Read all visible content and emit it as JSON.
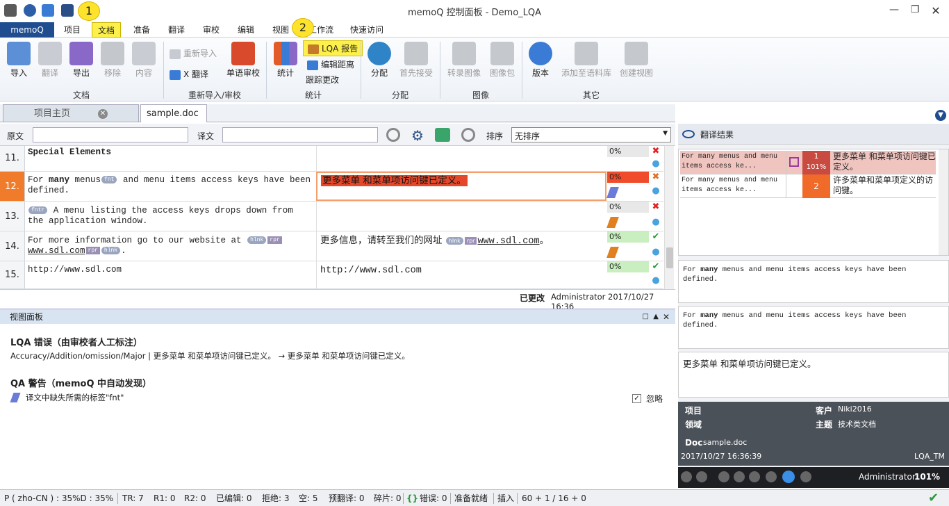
{
  "window": {
    "title": "memoQ 控制面板 - Demo_LQA"
  },
  "callouts": {
    "one": "1",
    "two": "2"
  },
  "tabs": {
    "memoq": "memoQ",
    "project": "项目",
    "document": "文档",
    "prepare": "准备",
    "translate": "翻译",
    "review": "审校",
    "edit": "编辑",
    "view": "视图",
    "workflow": "工作流",
    "quick": "快速访问"
  },
  "ribbon": {
    "import": "导入",
    "translate": "翻译",
    "export": "导出",
    "remove": "移除",
    "content": "内容",
    "group_doc": "文档",
    "reimport": "重新导入",
    "xtranslate": "X 翻译",
    "bilingual_review": "单语审校",
    "group_reimport": "重新导入/审校",
    "stats": "统计",
    "lqa_report": "LQA 报告",
    "edit_distance": "编辑距离",
    "track_changes": "跟踪更改",
    "group_stats": "统计",
    "assign": "分配",
    "first_accept": "首先接受",
    "group_assign": "分配",
    "transcribe_image": "转录图像",
    "image_pack": "图像包",
    "group_image": "图像",
    "version": "版本",
    "add_to_corpus": "添加至语料库",
    "create_view": "创建视图",
    "group_other": "其它"
  },
  "doctabs": {
    "home": "项目主页",
    "doc": "sample.doc"
  },
  "filter": {
    "source_label": "原文",
    "target_label": "译文",
    "sort_label": "排序",
    "sort_value": "无排序",
    "source_value": "",
    "target_value": ""
  },
  "rows": [
    {
      "num": "11.",
      "src": "Special Elements",
      "tgt": "",
      "pct": "0%"
    },
    {
      "num": "12.",
      "src_a": "For ",
      "src_b": "many",
      "src_c": " menus",
      "tag1": "fnt",
      "src_d": " and menu items access keys have been defined.",
      "tgt": "更多菜单 和菜单项访问键已定义。",
      "pct": "0%"
    },
    {
      "num": "13.",
      "tag1": "fntr",
      "src": " A menu listing the access keys drops down from the application window.",
      "tgt": "",
      "pct": "0%"
    },
    {
      "num": "14.",
      "src_a": "For more information go to our website at ",
      "tag1": "hlnk",
      "tag2": "rpr",
      "src_b": "www.sdl.com",
      "tag3": "rpr",
      "tag4": "hlnk",
      "src_c": ".",
      "tgt_a": "更多信息，请转至我们的网址 ",
      "tgt_b": "www.sdl.com",
      "tgt_c": "。",
      "pct": "0%"
    },
    {
      "num": "15.",
      "src": "http://www.sdl.com",
      "tgt": "http://www.sdl.com",
      "pct": "0%"
    }
  ],
  "editinfo": {
    "status": "已更改",
    "who": "Administrator 2017/10/27 16:36"
  },
  "viewpanel": {
    "title": "视图面板",
    "lqa_heading": "LQA 错误（由审校者人工标注）",
    "lqa_line": "Accuracy/Addition/omission/Major |   更多菜单 和菜单项访问键已定义。 → 更多菜单 和菜单项访问键已定义。",
    "qa_heading": "QA 警告（memoQ 中自动发现）",
    "qa_line": "译文中缺失所需的标签\"fnt\"",
    "ignore": "忽略"
  },
  "right": {
    "title": "翻译结果",
    "r1_src": "For many menus  and menu items access ke... ",
    "r1_num": "1",
    "r1_pct": "101%",
    "r1_tgt": "更多菜单 和菜单项访问键已定义。",
    "r2_src": "For many menus  and menu items access ke... ",
    "r2_num": "2",
    "r2_tgt": "许多菜单和菜单项定义的访问键。",
    "cmp1_a": "For ",
    "cmp1_b": "many",
    "cmp1_c": " menus  and menu items access keys have been defined.",
    "cmp2_a": "For ",
    "cmp2_b": "many",
    "cmp2_c": " menus  and menu items access keys have been defined.",
    "cmp3": "更多菜单 和菜单项访问键已定义。",
    "meta": {
      "project_label": "项目",
      "domain_label": "领域",
      "client_label": "客户",
      "client": "Niki2016",
      "subject_label": "主题",
      "subject": "技术类文档",
      "doc_label": "Doc",
      "doc": "sample.doc",
      "date": "2017/10/27 16:36:39",
      "tm": "LQA_TM"
    },
    "user": "Administrator",
    "zoom": "101%"
  },
  "status": {
    "lang": "P ( zho-CN ) : 35%D : 35%",
    "tr": "TR: 7",
    "r1": "R1: 0",
    "r2": "R2: 0",
    "edited": "已编辑: 0",
    "rejected": "拒绝: 3",
    "empty": "空: 5",
    "pretrans": "预翻译: 0",
    "frag": "碎片: 0",
    "errors": "错误: 0",
    "ready": "准备就绪",
    "insert": "插入",
    "count": "60 + 1 / 16 + 0"
  }
}
